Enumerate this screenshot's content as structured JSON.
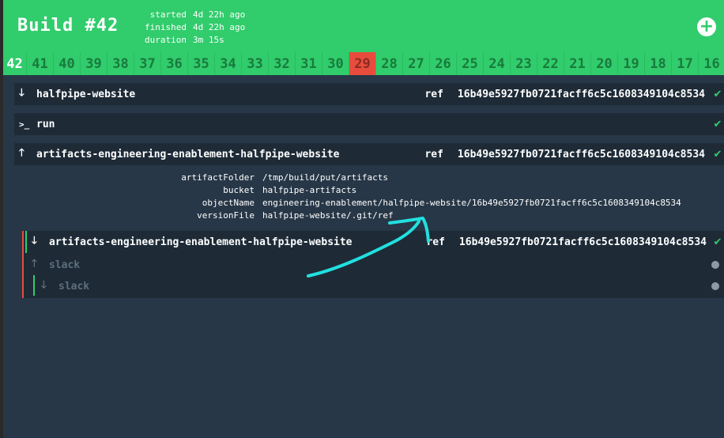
{
  "header": {
    "title": "Build #42",
    "started_label": "started",
    "started_value": "4d 22h ago",
    "finished_label": "finished",
    "finished_value": "4d 22h ago",
    "duration_label": "duration",
    "duration_value": "3m 15s",
    "add_icon": "plus-circle-icon"
  },
  "tabs": [
    "42",
    "41",
    "40",
    "39",
    "38",
    "37",
    "36",
    "35",
    "34",
    "33",
    "32",
    "31",
    "30",
    "29",
    "28",
    "27",
    "26",
    "25",
    "24",
    "23",
    "22",
    "21",
    "20",
    "19",
    "18",
    "17",
    "16"
  ],
  "resources": {
    "halfpipe": {
      "name": "halfpipe-website",
      "ref_label": "ref",
      "sha": "16b49e5927fb0721facff6c5c1608349104c8534"
    },
    "run": {
      "name": "run"
    },
    "artifacts": {
      "name": "artifacts-engineering-enablement-halfpipe-website",
      "ref_label": "ref",
      "sha": "16b49e5927fb0721facff6c5c1608349104c8534"
    }
  },
  "metadata": {
    "artifactFolder_key": "artifactFolder",
    "artifactFolder_val": "/tmp/build/put/artifacts",
    "bucket_key": "bucket",
    "bucket_val": "halfpipe-artifacts",
    "objectName_key": "objectName",
    "objectName_val": "engineering-enablement/halfpipe-website/16b49e5927fb0721facff6c5c1608349104c8534",
    "versionFile_key": "versionFile",
    "versionFile_val": "halfpipe-website/.git/ref"
  },
  "nested": {
    "get": {
      "name": "artifacts-engineering-enablement-halfpipe-website",
      "ref_label": "ref",
      "sha": "16b49e5927fb0721facff6c5c1608349104c8534"
    },
    "slack_put": {
      "name": "slack"
    },
    "slack_get": {
      "name": "slack"
    }
  },
  "colors": {
    "success": "#31cc6c",
    "failed": "#e74c3c",
    "annotation": "#22e0e0"
  }
}
